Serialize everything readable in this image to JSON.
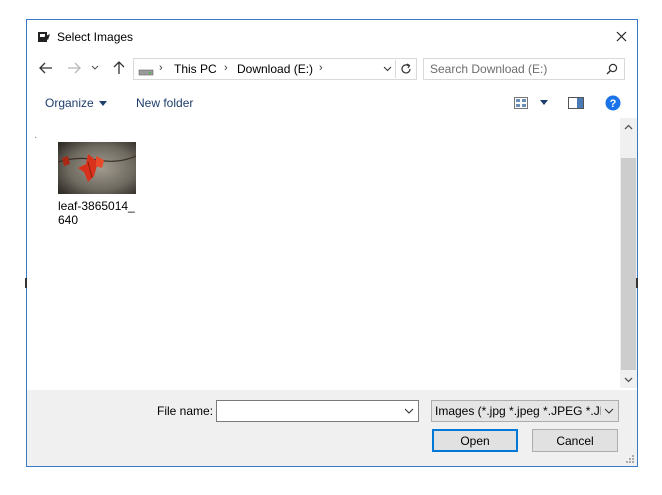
{
  "window": {
    "title": "Select Images"
  },
  "navigation": {
    "breadcrumbs": [
      "This PC",
      "Download (E:)"
    ],
    "search_placeholder": "Search Download (E:)"
  },
  "commands": {
    "organize_label": "Organize",
    "new_folder_label": "New folder"
  },
  "files": [
    {
      "name": "leaf-3865014_640",
      "type": "image"
    }
  ],
  "footer": {
    "file_name_label": "File name:",
    "file_name_value": "",
    "file_type_selected": "Images (*.jpg *.jpeg *.JPEG *.JPG *.png *.PNG)",
    "open_label": "Open",
    "cancel_label": "Cancel"
  },
  "colors": {
    "accent": "#0078d7",
    "link": "#1e3e6e",
    "panel": "#f0f0f0",
    "help": "#1a73e8"
  }
}
